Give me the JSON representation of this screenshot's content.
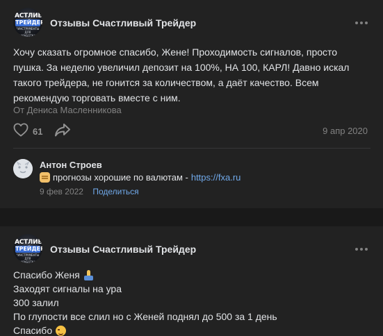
{
  "post1": {
    "avatar": {
      "line1": "АСТЛИВ",
      "line2": "ТРЕЙДЕР",
      "line3": "\"ИНСТРУМЕНТЫ ДЛЯ ЗАРАБОТКА\""
    },
    "group_name": "Отзывы Счастливый Трейдер",
    "text": "Хочу сказать огромное спасибо, Жене! Проходимость сигналов, просто пушка. За неделю увеличил депозит на 100%, НА 100, КАРЛ! Давно искал такого трейдера, не гонится за количеством, а даёт качество. Всем рекомендую торговать вместе с ним.",
    "signed": "От Дениса Масленникова",
    "likes": "61",
    "date": "9 апр 2020",
    "icons": {
      "like": "heart-icon",
      "share": "share-arrow-icon",
      "more": "more-dots-icon"
    },
    "comment": {
      "author": "Антон Строев",
      "text": "прогнозы хорошие по валютам - ",
      "link": "https://fxa.ru",
      "date": "9 фев 2022",
      "share_label": "Поделиться"
    }
  },
  "post2": {
    "avatar": {
      "line1": "АСТЛИВ",
      "line2": "ТРЕЙДЕР",
      "line3": "\"ИНСТРУМЕНТЫ ДЛЯ ЗАРАБОТКА\""
    },
    "group_name": "Отзывы Счастливый Трейдер",
    "lines": [
      "Спасибо Женя",
      "Заходят сигналы на ура",
      "300 залил",
      "По глупости все слил но с Женей поднял до 500 за 1 день",
      "Спасибо"
    ]
  },
  "colors": {
    "background": "#191919",
    "card": "#222222",
    "text": "#e1e3e6",
    "secondary": "#828282",
    "link": "#71aaeb"
  }
}
